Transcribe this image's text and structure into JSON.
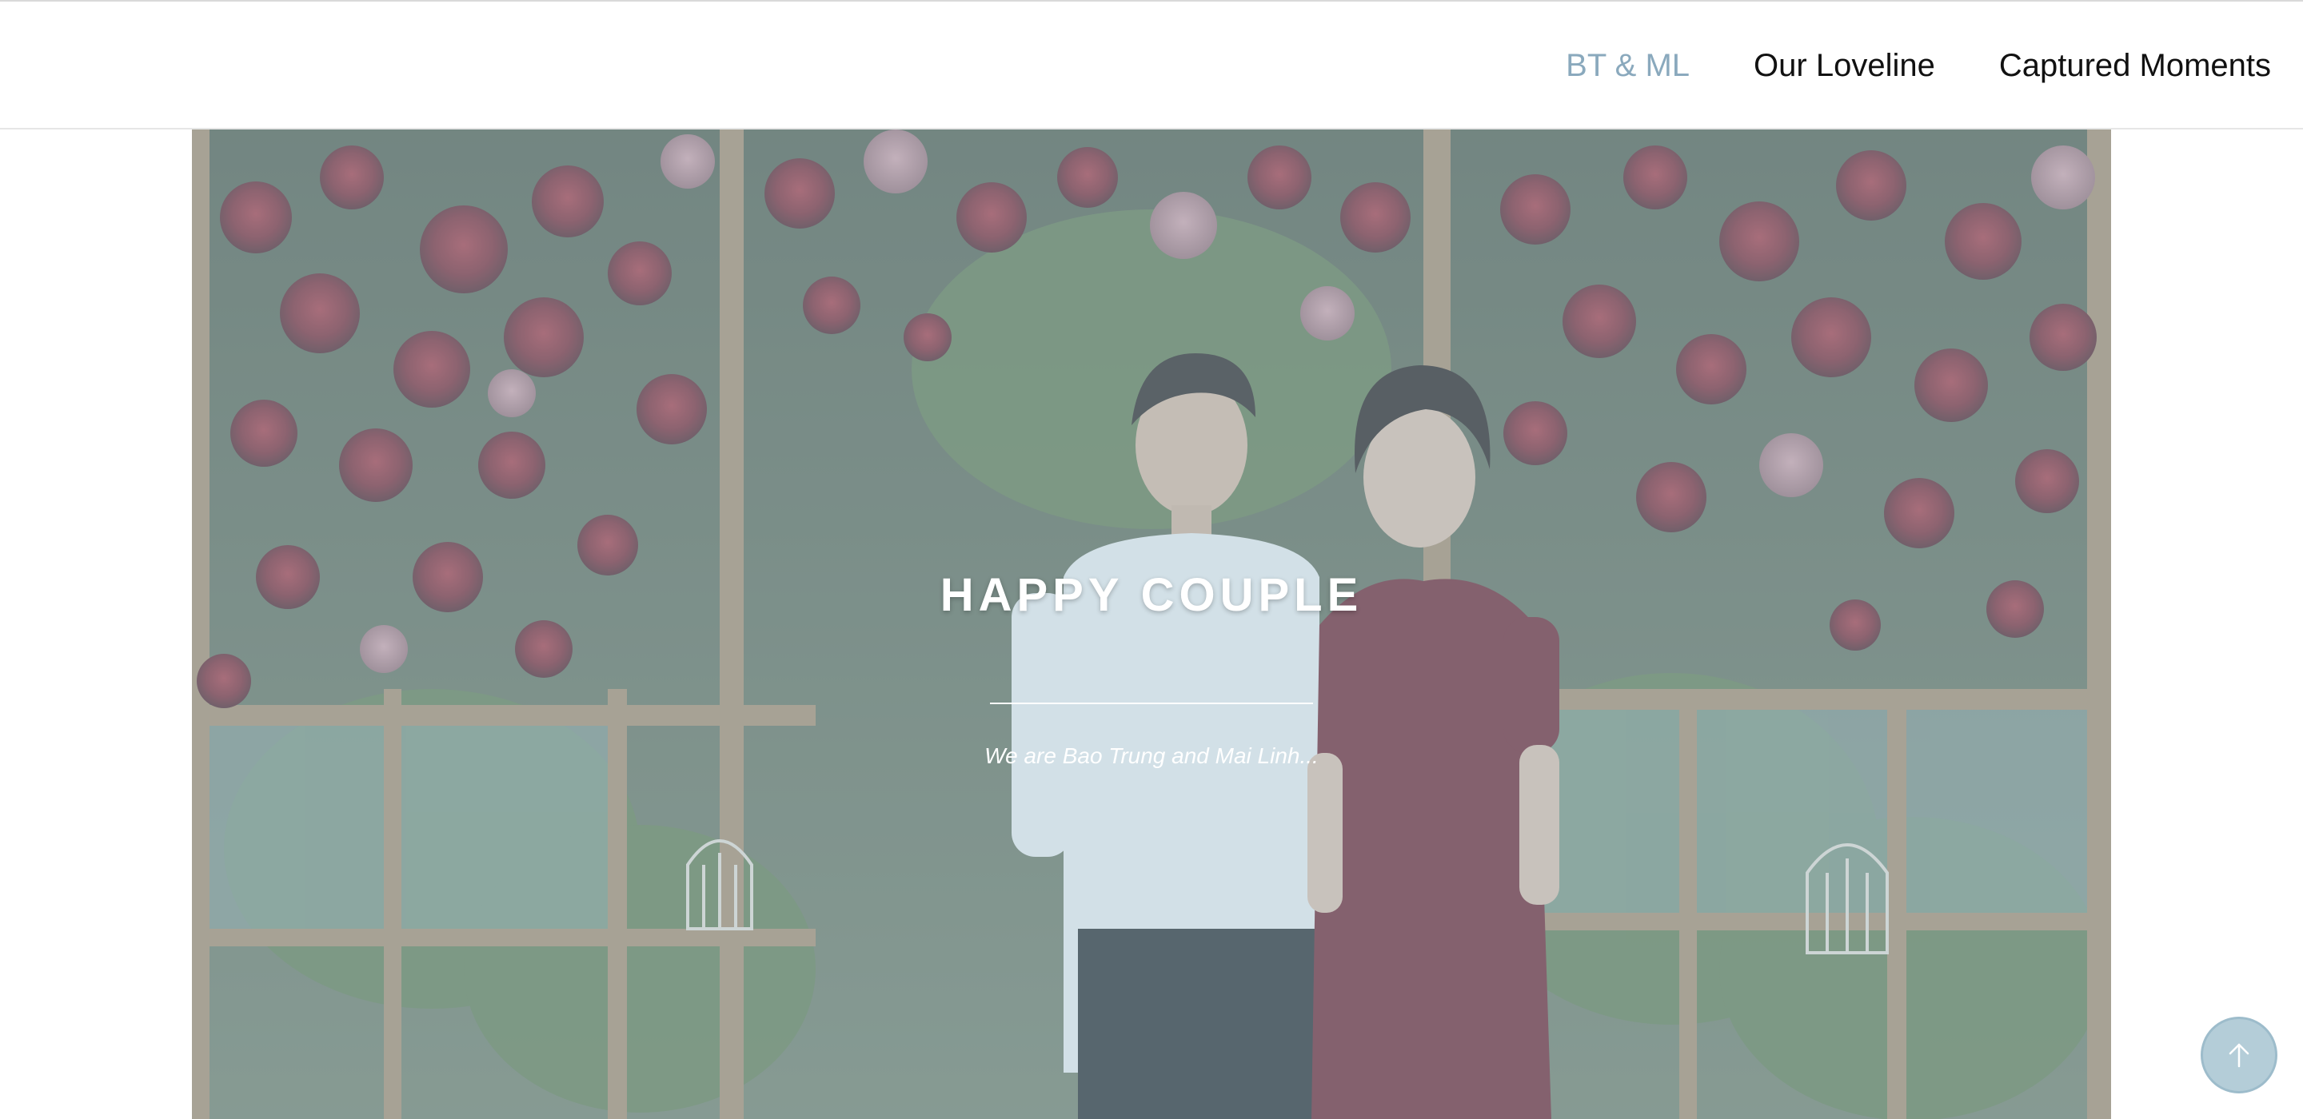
{
  "nav": {
    "items": [
      {
        "label": "BT & ML",
        "active": true
      },
      {
        "label": "Our Loveline",
        "active": false
      },
      {
        "label": "Captured Moments",
        "active": false
      }
    ]
  },
  "hero": {
    "title": "HAPPY COUPLE",
    "subtitle": "We are Bao Trung and Mai Linh..."
  },
  "scroll_top": {
    "icon": "arrow-up-icon"
  },
  "colors": {
    "active_nav": "#8aa9bd",
    "overlay": "#a8c4d2",
    "scroll_button": "#b4cdd8"
  }
}
